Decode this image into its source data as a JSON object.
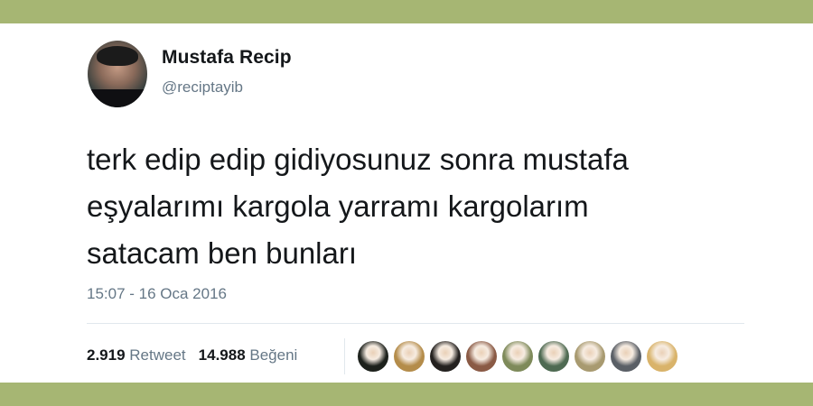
{
  "user": {
    "name": "Mustafa Recip",
    "handle": "@reciptayib"
  },
  "tweet": {
    "lines": [
      "terk edip edip gidiyosunuz sonra mustafa",
      "eşyalarımı kargola yarramı kargolarım",
      "satacam ben bunları"
    ],
    "timestamp": "15:07 - 16 Oca 2016"
  },
  "stats": {
    "retweet_count": "2.919",
    "retweet_label": "Retweet",
    "like_count": "14.988",
    "like_label": "Beğeni"
  },
  "liker_avatars": [
    {
      "icon": "liker-avatar-icon",
      "color": "#1d211c"
    },
    {
      "icon": "liker-avatar-icon",
      "color": "#b48c4a"
    },
    {
      "icon": "liker-avatar-icon",
      "color": "#24211f"
    },
    {
      "icon": "liker-avatar-icon",
      "color": "#8a5a45"
    },
    {
      "icon": "liker-avatar-icon",
      "color": "#7e8a5a"
    },
    {
      "icon": "liker-avatar-icon",
      "color": "#4e6a52"
    },
    {
      "icon": "liker-avatar-icon",
      "color": "#a89a70"
    },
    {
      "icon": "liker-avatar-icon",
      "color": "#5a5f66"
    },
    {
      "icon": "liker-avatar-icon",
      "color": "#d9b36a"
    }
  ],
  "colors": {
    "frame": "#a6b673",
    "text_primary": "#14171a",
    "text_secondary": "#657786",
    "divider": "#e1e8ed"
  }
}
